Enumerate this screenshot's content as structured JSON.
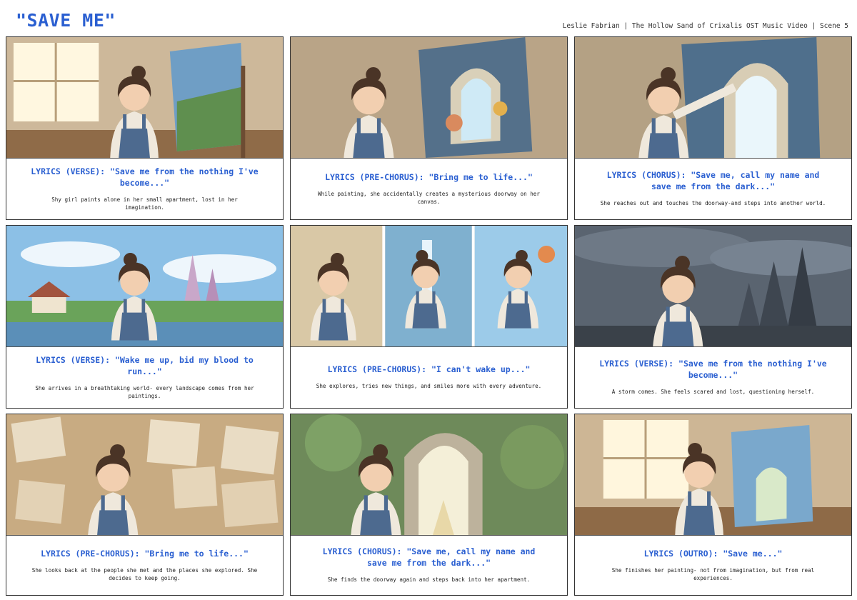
{
  "header": {
    "title": "\"SAVE ME\"",
    "credit": "Leslie Fabrian | The Hollow Sand of Crixalis OST Music Video | Scene 5"
  },
  "colors": {
    "accent": "#2a5fd1",
    "border": "#333333"
  },
  "panels": [
    {
      "lyric": "LYRICS (VERSE): \"Save me from the nothing I've become...\"",
      "description": "Shy girl paints alone in her small apartment, lost in her imagination.",
      "art": "apartment"
    },
    {
      "lyric": "LYRICS (PRE-CHORUS): \"Bring me to life...\"",
      "description": "While painting, she accidentally creates a mysterious doorway on her canvas.",
      "art": "doorway"
    },
    {
      "lyric": "LYRICS (CHORUS): \"Save me, call my name and save me from the dark...\"",
      "description": "She reaches out and touches the doorway-and steps into another world.",
      "art": "touch"
    },
    {
      "lyric": "LYRICS (VERSE): \"Wake me up, bid my blood to run...\"",
      "description": "She arrives in a breathtaking world- every landscape comes from her paintings.",
      "art": "world"
    },
    {
      "lyric": "LYRICS (PRE-CHORUS): \"I can't wake up...\"",
      "description": "She explores, tries new things, and smiles more with every adventure.",
      "art": "explore"
    },
    {
      "lyric": "LYRICS (VERSE): \"Save me from the nothing I've become...\"",
      "description": "A storm comes. She feels scared and lost, questioning herself.",
      "art": "storm"
    },
    {
      "lyric": "LYRICS (PRE-CHORUS): \"Bring me to life...\"",
      "description": "She looks back at the people she met and the places she explored. She decides to keep going.",
      "art": "memories"
    },
    {
      "lyric": "LYRICS (CHORUS): \"Save me, call my name and save me from the dark...\"",
      "description": "She finds the doorway again and steps back into her apartment.",
      "art": "return"
    },
    {
      "lyric": "LYRICS (OUTRO): \"Save me...\"",
      "description": "She finishes her painting- not from imagination, but from real experiences.",
      "art": "finish"
    }
  ]
}
